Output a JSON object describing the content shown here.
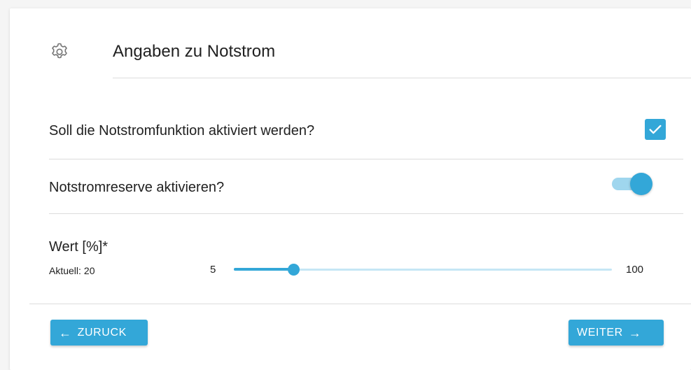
{
  "header": {
    "icon": "gear-icon",
    "title": "Angaben zu Notstrom"
  },
  "notstrom_function": {
    "label": "Soll die Notstromfunktion aktiviert werden?",
    "checked": true
  },
  "notstrom_reserve": {
    "label": "Notstromreserve aktivieren?",
    "enabled": true
  },
  "wert": {
    "label": "Wert [%]*",
    "current_label": "Aktuell:",
    "current_value": "20",
    "value": 20,
    "min": "5",
    "max": "100",
    "min_value": 5,
    "max_value": 100
  },
  "navigation": {
    "back_label": "ZURUCK",
    "next_label": "WEITER"
  },
  "colors": {
    "accent": "#33a7d8",
    "accent_light": "#9fd6ee",
    "rail_light": "#c5e6f5",
    "divider": "#dcdcdc"
  }
}
